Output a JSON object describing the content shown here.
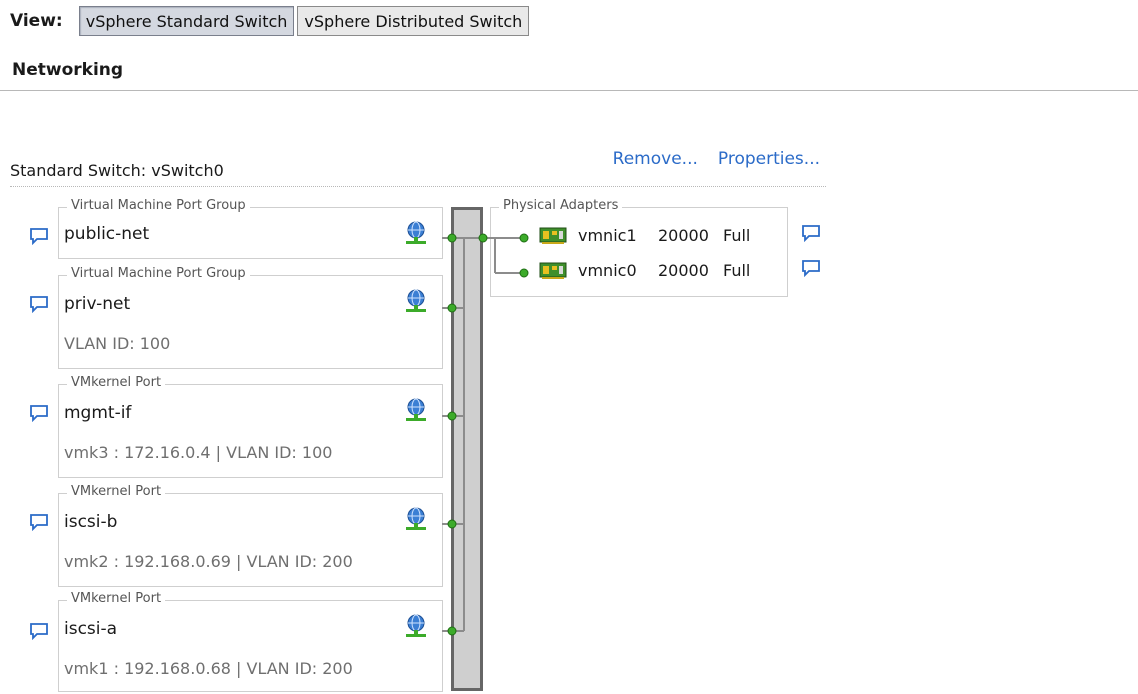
{
  "view": {
    "label": "View:",
    "buttons": [
      "vSphere Standard Switch",
      "vSphere Distributed Switch"
    ],
    "active": "vSphere Standard Switch"
  },
  "section_title": "Networking",
  "switch": {
    "title": "Standard Switch: vSwitch0",
    "remove_link": "Remove...",
    "properties_link": "Properties..."
  },
  "port_groups": [
    {
      "type": "Virtual Machine Port Group",
      "name": "public-net",
      "detail": "",
      "icon": "vm-network-icon"
    },
    {
      "type": "Virtual Machine Port Group",
      "name": "priv-net",
      "detail": "VLAN ID: 100",
      "icon": "vm-network-icon"
    },
    {
      "type": "VMkernel Port",
      "name": "mgmt-if",
      "detail": "vmk3 : 172.16.0.4 | VLAN ID: 100",
      "icon": "vmkernel-icon"
    },
    {
      "type": "VMkernel Port",
      "name": "iscsi-b",
      "detail": "vmk2 : 192.168.0.69 | VLAN ID: 200",
      "icon": "vmkernel-icon"
    },
    {
      "type": "VMkernel Port",
      "name": "iscsi-a",
      "detail": "vmk1 : 192.168.0.68 | VLAN ID: 200",
      "icon": "vmkernel-icon"
    }
  ],
  "physical_adapters": {
    "title": "Physical Adapters",
    "adapters": [
      {
        "name": "vmnic1",
        "speed": "20000",
        "duplex": "Full",
        "icon": "nic-icon"
      },
      {
        "name": "vmnic0",
        "speed": "20000",
        "duplex": "Full",
        "icon": "nic-icon"
      }
    ]
  },
  "colors": {
    "link": "#2b6bc8",
    "connector_green": "#3cab2a",
    "switch_bar_fill": "#cfcfcf",
    "switch_bar_border": "#666666"
  }
}
